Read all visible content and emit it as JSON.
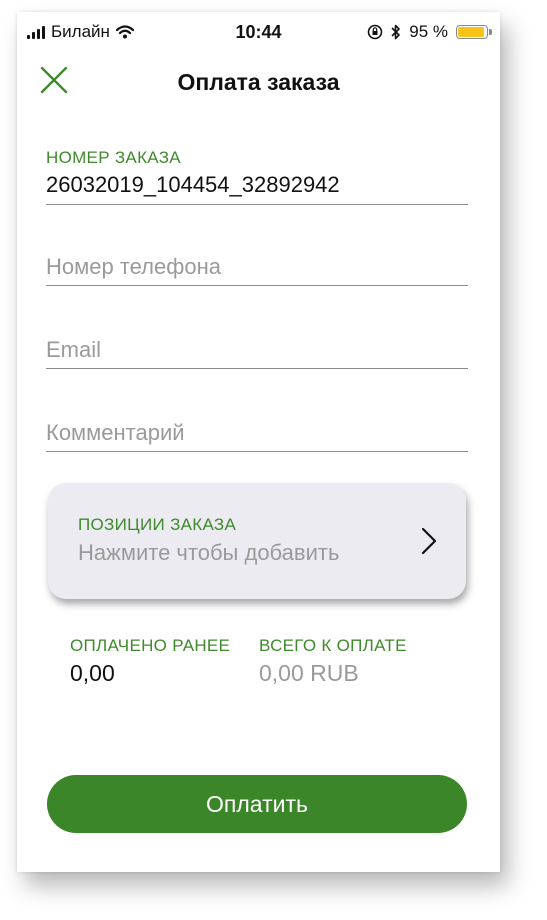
{
  "status_bar": {
    "carrier": "Билайн",
    "time": "10:44",
    "battery_percent_text": "95 %",
    "battery_level": 0.95,
    "icons": [
      "signal-bars-icon",
      "wifi-icon",
      "orientation-lock-icon",
      "bluetooth-icon",
      "battery-icon"
    ]
  },
  "nav": {
    "title": "Оплата заказа",
    "close_icon": "close-icon"
  },
  "form": {
    "order_number_label": "НОМЕР ЗАКАЗА",
    "order_number_value": "26032019_104454_32892942",
    "phone_placeholder": "Номер телефона",
    "email_placeholder": "Email",
    "comment_placeholder": "Комментарий"
  },
  "positions": {
    "title": "ПОЗИЦИИ ЗАКАЗА",
    "hint": "Нажмите чтобы добавить",
    "icon": "chevron-right-icon"
  },
  "totals": {
    "paid_label": "ОПЛАЧЕНО РАНЕЕ",
    "paid_value": "0,00",
    "total_label": "ВСЕГО К ОПЛАТЕ",
    "total_value": "0,00 RUB"
  },
  "pay_button": {
    "label": "Оплатить"
  },
  "colors": {
    "accent_green": "#3f8a2c",
    "button_green": "#3a8629",
    "placeholder_gray": "#9a9a9a",
    "card_bg": "#ecebf2",
    "battery_yellow": "#f6c41b"
  }
}
